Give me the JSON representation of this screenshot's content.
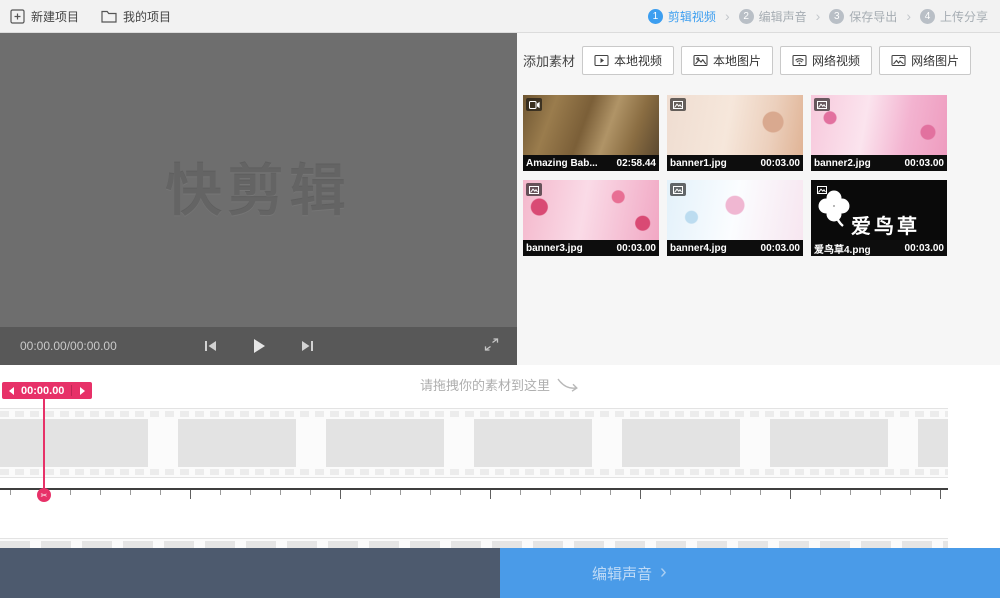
{
  "topbar": {
    "new_project": "新建项目",
    "my_projects": "我的项目",
    "steps": [
      {
        "num": "1",
        "label": "剪辑视频"
      },
      {
        "num": "2",
        "label": "编辑声音"
      },
      {
        "num": "3",
        "label": "保存导出"
      },
      {
        "num": "4",
        "label": "上传分享"
      }
    ]
  },
  "preview": {
    "watermark": "快剪辑",
    "timecode": "00:00.00/00:00.00"
  },
  "library": {
    "add_label": "添加素材",
    "buttons": [
      {
        "label": "本地视频"
      },
      {
        "label": "本地图片"
      },
      {
        "label": "网络视频"
      },
      {
        "label": "网络图片"
      }
    ],
    "items": [
      {
        "name": "Amazing Bab...",
        "duration": "02:58.44",
        "type": "video"
      },
      {
        "name": "banner1.jpg",
        "duration": "00:03.00",
        "type": "image"
      },
      {
        "name": "banner2.jpg",
        "duration": "00:03.00",
        "type": "image"
      },
      {
        "name": "banner3.jpg",
        "duration": "00:03.00",
        "type": "image"
      },
      {
        "name": "banner4.jpg",
        "duration": "00:03.00",
        "type": "image"
      },
      {
        "name": "爱鸟草4.png",
        "duration": "00:03.00",
        "type": "image",
        "overlay_text": "爱鸟草"
      }
    ]
  },
  "timeline": {
    "drop_hint": "请拖拽你的素材到这里",
    "playhead_time": "00:00.00"
  },
  "footer": {
    "next_label": "编辑声音"
  },
  "icons": {
    "chevron_right": "›",
    "scissors": "✂",
    "next_chevron": "›"
  },
  "colors": {
    "accent_blue": "#3c9ef0",
    "playhead_pink": "#e73168",
    "footer_blue": "#4a9be8",
    "footer_dark": "#4d5a6e",
    "preview_gray": "#6e6e6e"
  }
}
